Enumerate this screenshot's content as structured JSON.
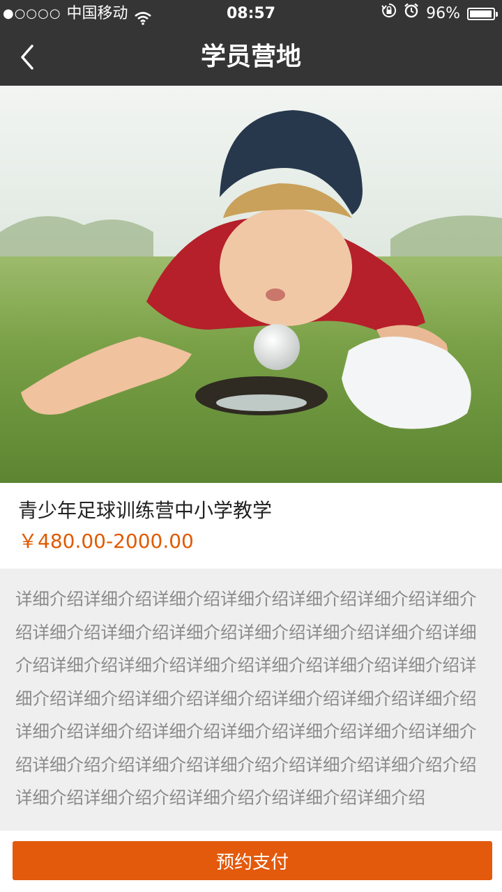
{
  "status_bar": {
    "signal": "●○○○○",
    "carrier": "中国移动",
    "time": "08:57",
    "battery_percent": "96%",
    "battery_level": 0.96,
    "icons": [
      "signal-dots-icon",
      "wifi-icon",
      "rotation-lock-icon",
      "alarm-icon",
      "battery-icon"
    ]
  },
  "nav": {
    "back_icon": "chevron-left-icon",
    "title": "学员营地"
  },
  "hero_image": {
    "subject": "photo"
  },
  "product": {
    "title": "青少年足球训练营中小学教学",
    "price": "￥480.00-2000.00"
  },
  "description": {
    "text": "详细介绍详细介绍详细介绍详细介绍详细介绍详细介绍详细介绍详细介绍详细介绍详细介绍详细介绍详细介绍详细介绍详细介绍详细介绍详细介绍详细介绍详细介绍详细介绍详细介绍详细介绍详细介绍详细介绍详细介绍详细介绍详细介绍详细介绍详细介绍详细介绍详细介绍详细介绍详细介绍详细介绍详细介绍详细介绍介绍详细介绍详细介绍介绍详细介绍详细介绍介绍详细介绍详细介绍介绍详细介绍介绍详细介绍详细介绍"
  },
  "footer": {
    "pay_label": "预约支付"
  },
  "colors": {
    "header_bg": "#353535",
    "accent": "#e35a0c",
    "price": "#e05a00",
    "description_bg": "#efefef"
  }
}
